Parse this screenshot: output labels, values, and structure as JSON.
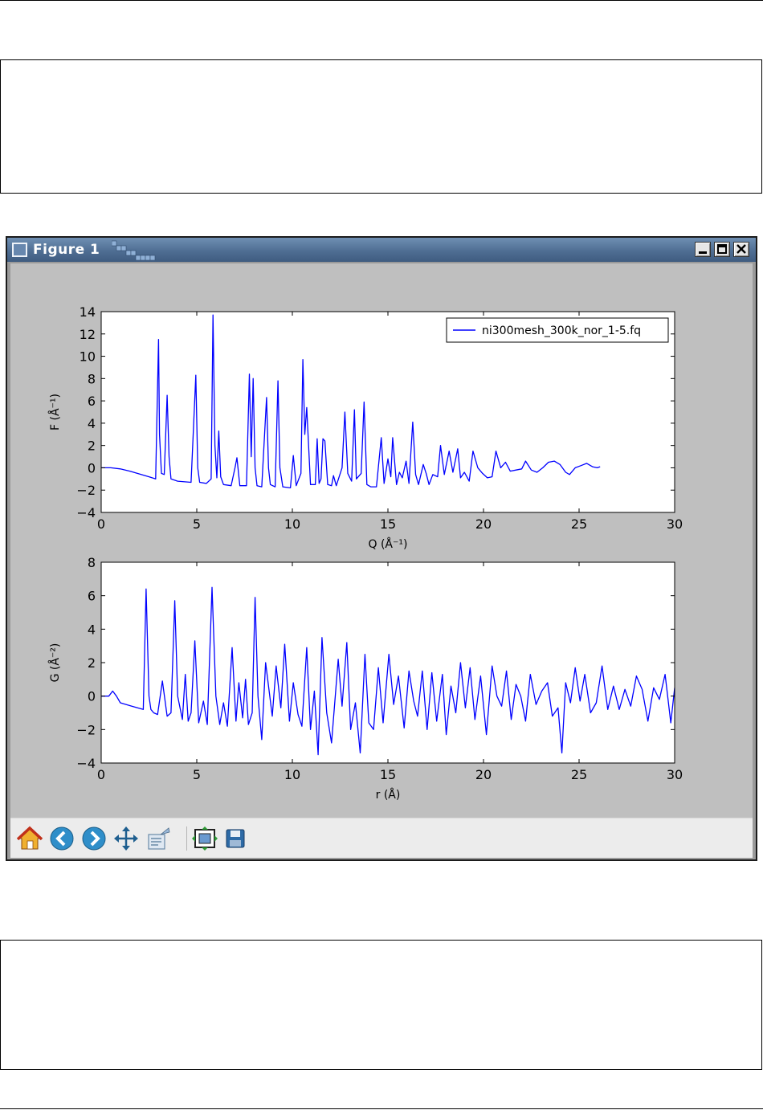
{
  "window": {
    "title": "Figure 1",
    "controls": {
      "minimize_icon": "minimize-icon",
      "maximize_icon": "maximize-icon",
      "close_icon": "close-icon"
    }
  },
  "toolbar": {
    "buttons": [
      {
        "name": "home",
        "icon": "home-icon"
      },
      {
        "name": "back",
        "icon": "back-arrow-icon"
      },
      {
        "name": "forward",
        "icon": "forward-arrow-icon"
      },
      {
        "name": "pan",
        "icon": "pan-arrows-icon"
      },
      {
        "name": "zoom",
        "icon": "zoom-rect-icon"
      },
      {
        "name": "subplots",
        "icon": "subplots-config-icon"
      },
      {
        "name": "save",
        "icon": "save-floppy-icon"
      }
    ]
  },
  "colors": {
    "line": "#0000ff",
    "canvas_bg": "#bfbfbf",
    "axes_bg": "#ffffff",
    "toolbar_bg": "#ececec"
  },
  "chart_data": [
    {
      "type": "line",
      "xlabel": "Q (Å⁻¹)",
      "ylabel": "F (Å⁻¹)",
      "xlim": [
        0,
        30
      ],
      "ylim": [
        -4,
        14
      ],
      "xticks": [
        0,
        5,
        10,
        15,
        20,
        25,
        30
      ],
      "yticks": [
        -4,
        -2,
        0,
        2,
        4,
        6,
        8,
        10,
        12,
        14
      ],
      "legend_position": "top-right",
      "series": [
        {
          "name": "ni300mesh_300k_nor_1-5.fq",
          "x": [
            0,
            0.5,
            1,
            1.5,
            2,
            2.5,
            2.85,
            3.0,
            3.05,
            3.15,
            3.3,
            3.45,
            3.55,
            3.65,
            4.0,
            4.7,
            4.95,
            5.05,
            5.15,
            5.5,
            5.75,
            5.85,
            5.95,
            6.05,
            6.15,
            6.25,
            6.4,
            6.8,
            7.0,
            7.1,
            7.25,
            7.6,
            7.75,
            7.85,
            7.95,
            8.05,
            8.15,
            8.4,
            8.65,
            8.75,
            8.85,
            9.1,
            9.25,
            9.35,
            9.5,
            9.9,
            10.05,
            10.2,
            10.45,
            10.55,
            10.65,
            10.75,
            10.95,
            11.2,
            11.3,
            11.4,
            11.5,
            11.6,
            11.7,
            11.85,
            12.05,
            12.15,
            12.3,
            12.6,
            12.75,
            12.9,
            13.1,
            13.25,
            13.35,
            13.6,
            13.75,
            13.9,
            14.1,
            14.4,
            14.65,
            14.8,
            15.0,
            15.15,
            15.25,
            15.45,
            15.6,
            15.75,
            15.95,
            16.1,
            16.3,
            16.45,
            16.6,
            16.85,
            17.0,
            17.15,
            17.35,
            17.6,
            17.75,
            17.95,
            18.2,
            18.4,
            18.65,
            18.8,
            19.0,
            19.25,
            19.45,
            19.7,
            19.95,
            20.2,
            20.45,
            20.65,
            20.9,
            21.15,
            21.4,
            21.7,
            22.0,
            22.2,
            22.5,
            22.8,
            23.1,
            23.4,
            23.7,
            24.0,
            24.3,
            24.5,
            24.8,
            25.1,
            25.4,
            25.7,
            25.95,
            26.1
          ],
          "y": [
            0.0,
            0.0,
            -0.1,
            -0.3,
            -0.55,
            -0.8,
            -1.0,
            11.5,
            3.0,
            -0.5,
            -0.6,
            6.5,
            1.0,
            -1.0,
            -1.2,
            -1.3,
            8.3,
            0.0,
            -1.3,
            -1.4,
            -1.0,
            13.7,
            2.0,
            -0.9,
            3.3,
            -0.8,
            -1.5,
            -1.6,
            0.0,
            0.9,
            -1.6,
            -1.6,
            8.4,
            1.0,
            8.0,
            0.0,
            -1.6,
            -1.7,
            6.3,
            0.0,
            -1.5,
            -1.7,
            7.8,
            0.0,
            -1.7,
            -1.8,
            1.1,
            -1.6,
            -0.5,
            9.7,
            3.0,
            5.4,
            -1.5,
            -1.5,
            2.6,
            -1.4,
            -1.0,
            2.6,
            2.4,
            -1.5,
            -1.6,
            -0.7,
            -1.6,
            0.0,
            5.0,
            -0.5,
            -1.2,
            5.2,
            -1.0,
            -0.5,
            5.9,
            -1.5,
            -1.7,
            -1.7,
            2.7,
            -1.4,
            0.8,
            -0.8,
            2.7,
            -1.5,
            -0.4,
            -0.9,
            0.6,
            -1.4,
            4.1,
            -0.6,
            -1.5,
            0.3,
            -0.5,
            -1.5,
            -0.6,
            -0.8,
            2.0,
            -0.6,
            1.5,
            -0.4,
            1.7,
            -0.9,
            -0.4,
            -1.2,
            1.5,
            0.0,
            -0.5,
            -0.9,
            -0.8,
            1.5,
            0.0,
            0.5,
            -0.3,
            -0.2,
            -0.1,
            0.6,
            -0.2,
            -0.4,
            0.0,
            0.5,
            0.6,
            0.3,
            -0.4,
            -0.6,
            0.0,
            0.2,
            0.4,
            0.1,
            0.0,
            0.1
          ]
        }
      ]
    },
    {
      "type": "line",
      "xlabel": "r (Å)",
      "ylabel": "G (Å⁻²)",
      "xlim": [
        0,
        30
      ],
      "ylim": [
        -4,
        8
      ],
      "xticks": [
        0,
        5,
        10,
        15,
        20,
        25,
        30
      ],
      "yticks": [
        -4,
        -2,
        0,
        2,
        4,
        6,
        8
      ],
      "series": [
        {
          "x": [
            0,
            0.4,
            0.6,
            0.8,
            1.0,
            1.3,
            1.6,
            1.9,
            2.2,
            2.35,
            2.5,
            2.6,
            2.75,
            2.95,
            3.2,
            3.45,
            3.65,
            3.85,
            4.0,
            4.25,
            4.4,
            4.55,
            4.7,
            4.9,
            5.1,
            5.35,
            5.55,
            5.8,
            6.0,
            6.2,
            6.4,
            6.6,
            6.85,
            7.05,
            7.2,
            7.4,
            7.55,
            7.7,
            7.9,
            8.05,
            8.2,
            8.4,
            8.6,
            8.95,
            9.15,
            9.4,
            9.6,
            9.85,
            10.05,
            10.3,
            10.5,
            10.75,
            10.95,
            11.15,
            11.35,
            11.55,
            11.8,
            12.05,
            12.4,
            12.6,
            12.85,
            13.05,
            13.3,
            13.55,
            13.8,
            14.0,
            14.25,
            14.5,
            14.75,
            15.05,
            15.3,
            15.55,
            15.85,
            16.1,
            16.35,
            16.55,
            16.8,
            17.05,
            17.3,
            17.55,
            17.85,
            18.05,
            18.3,
            18.55,
            18.8,
            19.05,
            19.3,
            19.55,
            19.85,
            20.15,
            20.45,
            20.7,
            20.95,
            21.2,
            21.45,
            21.7,
            21.95,
            22.2,
            22.45,
            22.75,
            23.05,
            23.35,
            23.6,
            23.9,
            24.1,
            24.3,
            24.55,
            24.8,
            25.05,
            25.3,
            25.6,
            25.9,
            26.2,
            26.5,
            26.8,
            27.1,
            27.4,
            27.7,
            28.0,
            28.3,
            28.6,
            28.9,
            29.2,
            29.5,
            29.8,
            30.0
          ],
          "y": [
            0.0,
            0.0,
            0.3,
            0.0,
            -0.4,
            -0.5,
            -0.6,
            -0.7,
            -0.8,
            6.4,
            0.0,
            -0.8,
            -1.0,
            -1.1,
            0.9,
            -1.2,
            -1.0,
            5.7,
            0.0,
            -1.4,
            1.3,
            -1.5,
            -1.0,
            3.3,
            -1.6,
            -0.3,
            -1.7,
            6.5,
            0.0,
            -1.7,
            -0.4,
            -1.8,
            2.9,
            -1.5,
            0.8,
            -1.3,
            1.0,
            -1.7,
            -1.0,
            5.9,
            0.0,
            -2.6,
            2.0,
            -1.2,
            1.8,
            -0.7,
            3.1,
            -1.5,
            0.8,
            -1.1,
            -1.8,
            2.9,
            -2.0,
            0.3,
            -3.5,
            3.5,
            -1.0,
            -2.8,
            2.2,
            -0.6,
            3.2,
            -2.0,
            -0.4,
            -3.4,
            2.5,
            -1.6,
            -2.0,
            1.7,
            -1.6,
            2.5,
            -0.5,
            1.2,
            -1.9,
            1.5,
            -0.3,
            -1.2,
            1.5,
            -2.0,
            1.4,
            -1.5,
            1.3,
            -2.3,
            0.6,
            -1.0,
            2.0,
            -0.7,
            1.7,
            -1.4,
            1.2,
            -2.3,
            1.8,
            0.0,
            -0.6,
            1.5,
            -1.4,
            0.7,
            0.0,
            -1.5,
            1.3,
            -0.5,
            0.3,
            0.8,
            -1.2,
            -0.7,
            -3.4,
            0.8,
            -0.4,
            1.7,
            -0.3,
            1.3,
            -1.0,
            -0.4,
            1.8,
            -0.8,
            0.6,
            -0.8,
            0.4,
            -0.6,
            1.2,
            0.4,
            -1.5,
            0.5,
            -0.2,
            1.3,
            -1.6,
            0.5
          ]
        }
      ]
    }
  ]
}
